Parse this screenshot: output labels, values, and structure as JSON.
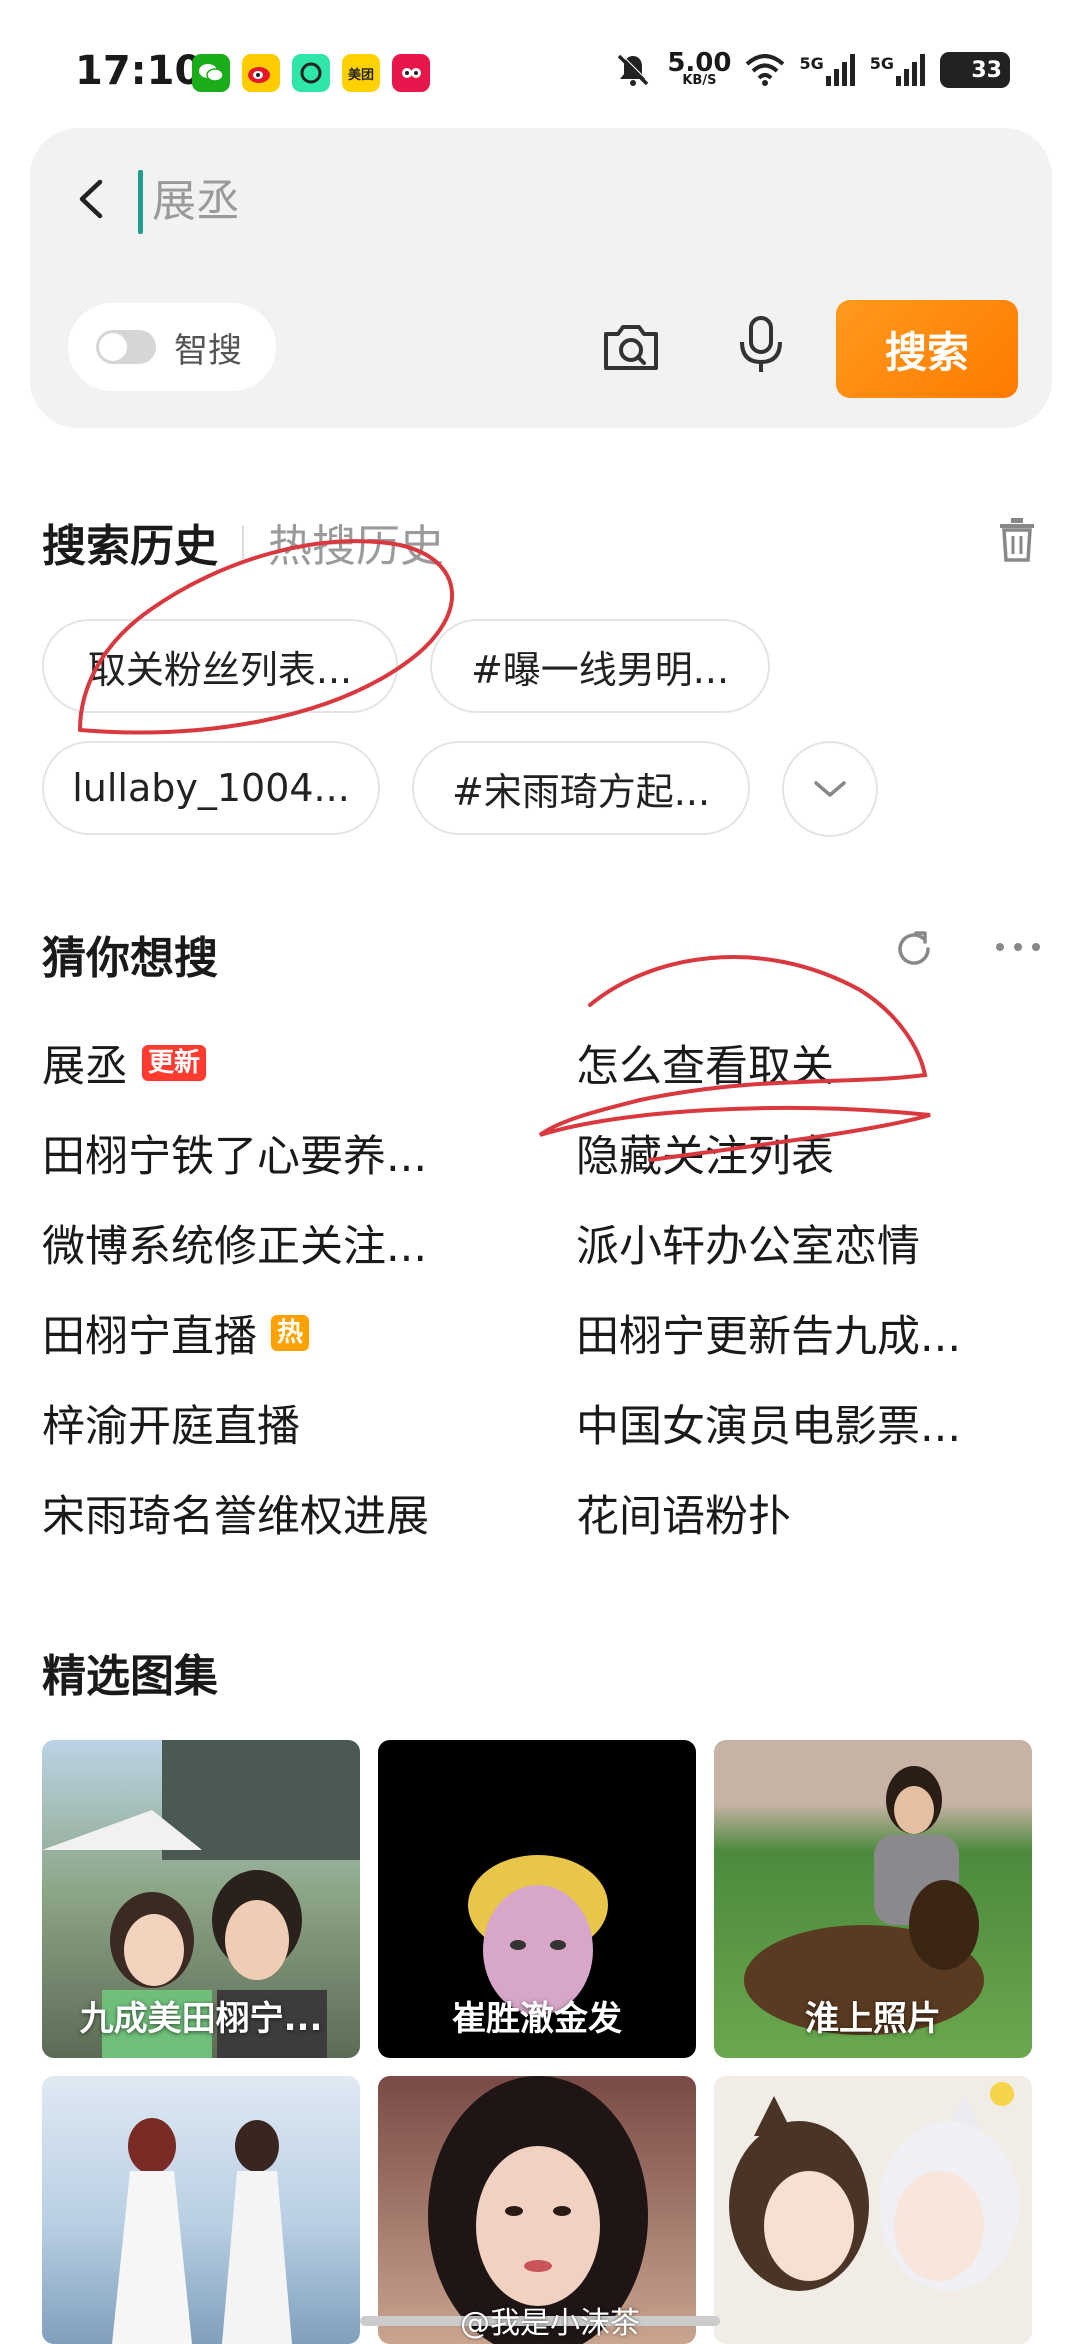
{
  "status_bar": {
    "time": "17:10",
    "net_speed": "5.00",
    "net_speed_unit": "KB/S",
    "signal_1": "5G",
    "signal_2": "5G",
    "battery": "33",
    "app_icons": [
      "wechat-icon",
      "weibo-icon",
      "camera-app-icon",
      "meituan-icon",
      "bird-app-icon"
    ],
    "meituan_label": "美团"
  },
  "search": {
    "placeholder": "展丞",
    "smart_search_label": "智搜",
    "search_button": "搜索"
  },
  "history": {
    "tab_active": "搜索历史",
    "tab_inactive": "热搜历史",
    "chips": [
      "取关粉丝列表...",
      "#曝一线男明...",
      "lullaby_1004...",
      "#宋雨琦方起..."
    ]
  },
  "guess": {
    "title": "猜你想搜",
    "left": [
      {
        "text": "展丞",
        "badge": "更新"
      },
      {
        "text": "田栩宁铁了心要养...",
        "badge": ""
      },
      {
        "text": "微博系统修正关注...",
        "badge": ""
      },
      {
        "text": "田栩宁直播",
        "badge": "热"
      },
      {
        "text": "梓渝开庭直播",
        "badge": ""
      },
      {
        "text": "宋雨琦名誉维权进展",
        "badge": ""
      }
    ],
    "right": [
      {
        "text": "怎么查看取关"
      },
      {
        "text": "隐藏关注列表"
      },
      {
        "text": "派小轩办公室恋情"
      },
      {
        "text": "田栩宁更新告九成..."
      },
      {
        "text": "中国女演员电影票..."
      },
      {
        "text": "花间语粉扑"
      }
    ]
  },
  "gallery": {
    "title": "精选图集",
    "tiles": [
      {
        "label": "九成美田栩宁..."
      },
      {
        "label": "崔胜澈金发"
      },
      {
        "label": "淮上照片"
      },
      {
        "label": ""
      },
      {
        "label": ""
      },
      {
        "label": ""
      }
    ]
  },
  "watermark": "@我是小沫茶"
}
